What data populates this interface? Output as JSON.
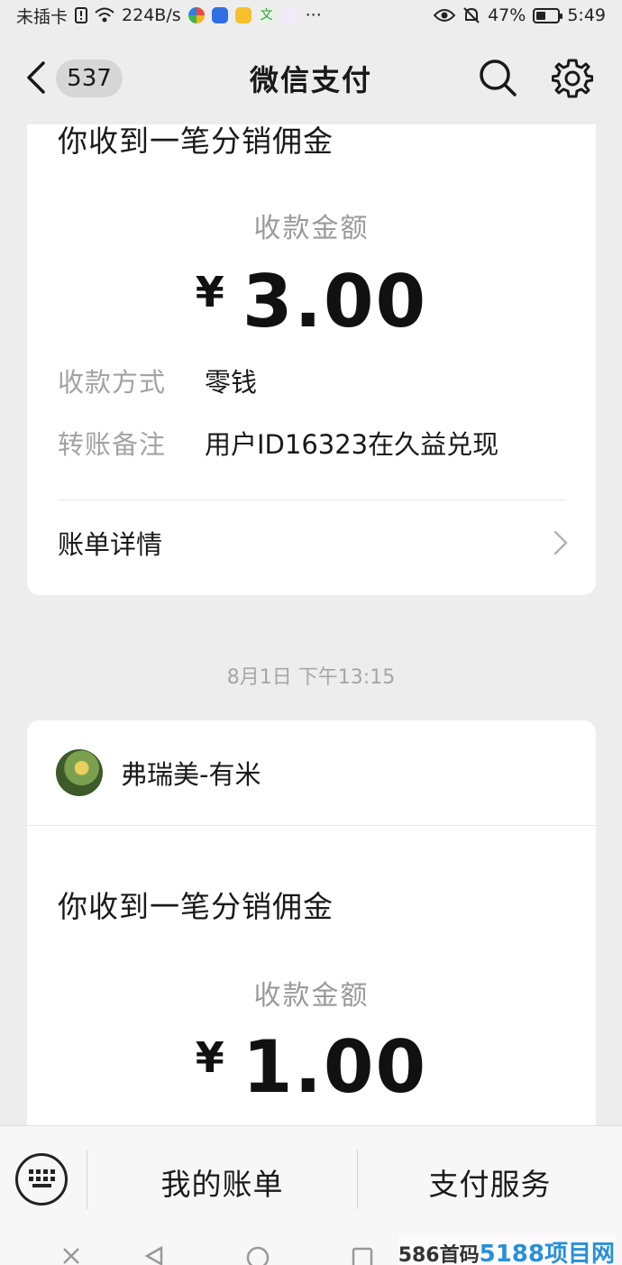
{
  "status_bar": {
    "carrier": "未插卡",
    "speed": "224B/s",
    "more": "···",
    "battery": "47%",
    "battery_level": 0.47,
    "time": "5:49"
  },
  "nav": {
    "unread_count": "537",
    "title": "微信支付"
  },
  "messages": [
    {
      "title": "你收到一笔分销佣金",
      "amount_label": "收款金额",
      "currency": "¥",
      "amount": "3.00",
      "method_key": "收款方式",
      "method_val": "零钱",
      "note_key": "转账备注",
      "note_val": "用户ID16323在久益兑现",
      "detail_label": "账单详情"
    },
    {
      "timestamp": "8月1日 下午13:15",
      "sender": "弗瑞美-有米",
      "title": "你收到一笔分销佣金",
      "amount_label": "收款金额",
      "currency": "¥",
      "amount": "1.00"
    }
  ],
  "bottom_bar": {
    "bill_label": "我的账单",
    "service_label": "支付服务"
  },
  "watermark": {
    "prefix": "586首码",
    "brand": "5188项目网"
  },
  "colors": {
    "background": "#ededed",
    "card": "#ffffff",
    "muted_text": "#9a9a9a"
  }
}
